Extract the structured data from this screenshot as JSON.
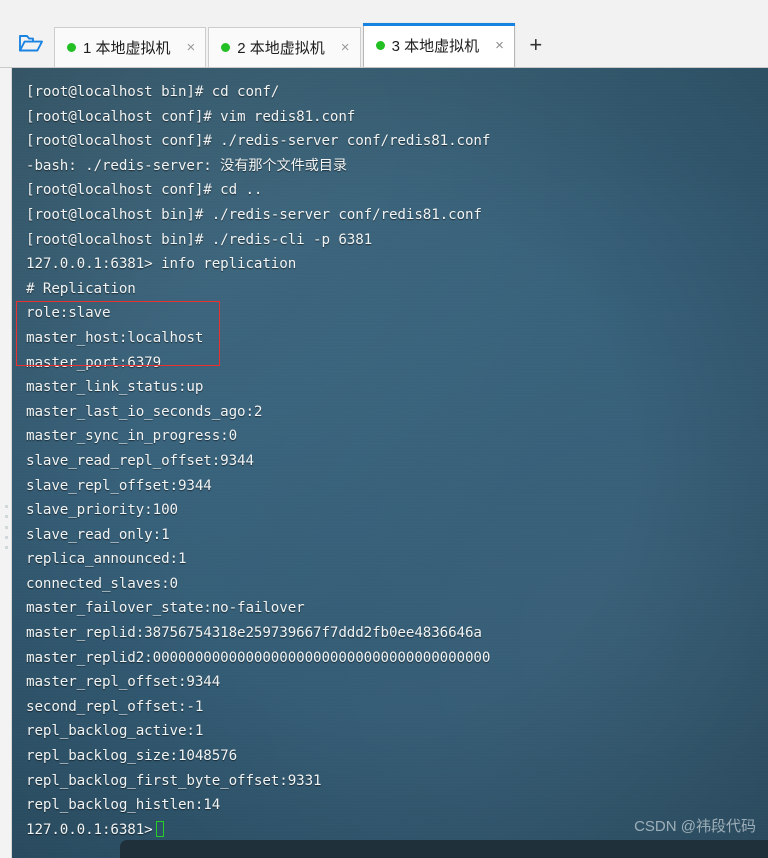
{
  "window": {
    "folder_icon": "open-folder-icon",
    "add_tab_label": "+",
    "close_glyph": "×"
  },
  "tabs": [
    {
      "index": "1",
      "label": "1 本地虚拟机",
      "status": "connected",
      "active": false
    },
    {
      "index": "2",
      "label": "2 本地虚拟机",
      "status": "connected",
      "active": false
    },
    {
      "index": "3",
      "label": "3 本地虚拟机",
      "status": "connected",
      "active": true
    }
  ],
  "terminal": {
    "prompt_host": "[root@localhost",
    "lines": [
      "[root@localhost bin]# cd conf/",
      "[root@localhost conf]# vim redis81.conf",
      "[root@localhost conf]# ./redis-server conf/redis81.conf",
      "-bash: ./redis-server: 没有那个文件或目录",
      "[root@localhost conf]# cd ..",
      "[root@localhost bin]# ./redis-server conf/redis81.conf",
      "[root@localhost bin]# ./redis-cli -p 6381",
      "127.0.0.1:6381> info replication",
      "# Replication",
      "role:slave",
      "master_host:localhost",
      "master_port:6379",
      "master_link_status:up",
      "master_last_io_seconds_ago:2",
      "master_sync_in_progress:0",
      "slave_read_repl_offset:9344",
      "slave_repl_offset:9344",
      "slave_priority:100",
      "slave_read_only:1",
      "replica_announced:1",
      "connected_slaves:0",
      "master_failover_state:no-failover",
      "master_replid:38756754318e259739667f7ddd2fb0ee4836646a",
      "master_replid2:0000000000000000000000000000000000000000",
      "master_repl_offset:9344",
      "second_repl_offset:-1",
      "repl_backlog_active:1",
      "repl_backlog_size:1048576",
      "repl_backlog_first_byte_offset:9331",
      "repl_backlog_histlen:14"
    ],
    "final_prompt": "127.0.0.1:6381>",
    "cursor": "block-cursor"
  },
  "annotation": {
    "name": "red-highlight-box",
    "color": "#ec2f2f",
    "covers": [
      "role:slave",
      "master_host:localhost",
      "master_port:6379"
    ]
  },
  "watermark": {
    "text": "CSDN @祎段代码"
  },
  "colors": {
    "terminal_bg": "#35607a",
    "accent_tab": "#1683e0",
    "status_dot": "#22c024",
    "cursor": "#25d024",
    "annotation": "#ec2f2f"
  }
}
